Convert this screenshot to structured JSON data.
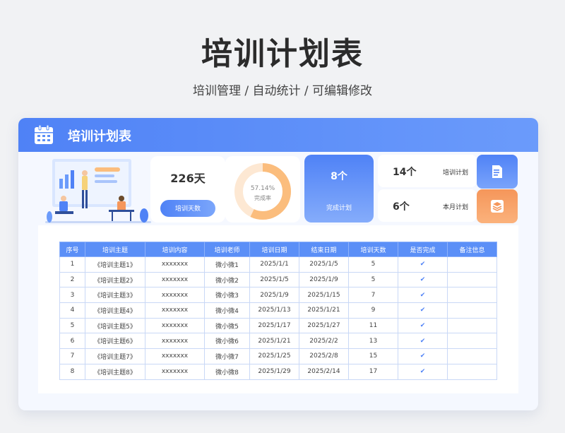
{
  "page": {
    "title": "培训计划表",
    "subtitle": "培训管理 / 自动统计 /  可编辑修改"
  },
  "card": {
    "title": "培训计划表",
    "icons": {
      "header": "calendar-icon",
      "plan": "document-icon",
      "month": "layers-icon"
    }
  },
  "stats": {
    "days_value": "226天",
    "days_label": "培训天数",
    "donut_percent": "57.14%",
    "donut_fraction": 0.5714,
    "donut_label": "完成率",
    "completed_value": "8个",
    "completed_label": "完成计划",
    "plan_value": "14个",
    "plan_label": "培训计划",
    "month_value": "6个",
    "month_label": "本月计划"
  },
  "colors": {
    "accent": "#4f82f6",
    "orange": "#f5965a",
    "donut_fill": "#fbbd7d",
    "donut_track": "#fde8d3"
  },
  "table": {
    "headers": [
      "序号",
      "培训主题",
      "培训内容",
      "培训老师",
      "培训日期",
      "结束日期",
      "培训天数",
      "是否完成",
      "备注信息"
    ],
    "rows": [
      [
        "1",
        "《培训主题1》",
        "xxxxxxx",
        "微小微1",
        "2025/1/1",
        "2025/1/5",
        "5",
        "✔",
        ""
      ],
      [
        "2",
        "《培训主题2》",
        "xxxxxxx",
        "微小微2",
        "2025/1/5",
        "2025/1/9",
        "5",
        "✔",
        ""
      ],
      [
        "3",
        "《培训主题3》",
        "xxxxxxx",
        "微小微3",
        "2025/1/9",
        "2025/1/15",
        "7",
        "✔",
        ""
      ],
      [
        "4",
        "《培训主题4》",
        "xxxxxxx",
        "微小微4",
        "2025/1/13",
        "2025/1/21",
        "9",
        "✔",
        ""
      ],
      [
        "5",
        "《培训主题5》",
        "xxxxxxx",
        "微小微5",
        "2025/1/17",
        "2025/1/27",
        "11",
        "✔",
        ""
      ],
      [
        "6",
        "《培训主题6》",
        "xxxxxxx",
        "微小微6",
        "2025/1/21",
        "2025/2/2",
        "13",
        "✔",
        ""
      ],
      [
        "7",
        "《培训主题7》",
        "xxxxxxx",
        "微小微7",
        "2025/1/25",
        "2025/2/8",
        "15",
        "✔",
        ""
      ],
      [
        "8",
        "《培训主题8》",
        "xxxxxxx",
        "微小微8",
        "2025/1/29",
        "2025/2/14",
        "17",
        "✔",
        ""
      ]
    ]
  }
}
